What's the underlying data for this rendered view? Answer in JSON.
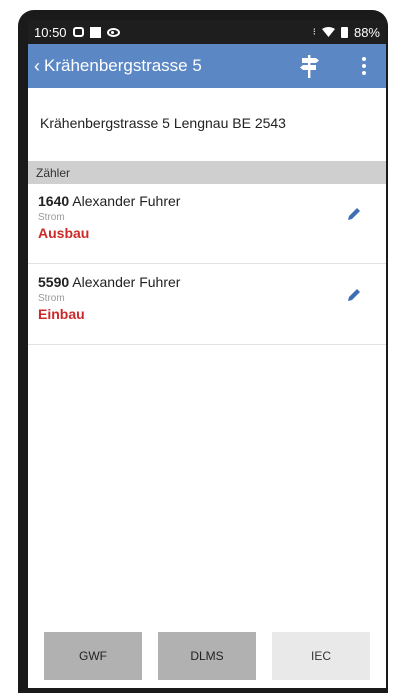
{
  "status_bar": {
    "time": "10:50",
    "signal": "⁝",
    "battery": "88%"
  },
  "app_bar": {
    "back_icon": "‹",
    "title": "Krähenbergstrasse 5",
    "signpost_icon": "signpost-icon",
    "more_icon": "more-vert-icon"
  },
  "address": "Krähenbergstrasse 5 Lengnau BE 2543",
  "section": {
    "title": "Zähler"
  },
  "items": [
    {
      "number": "1640",
      "name": " Alexander Fuhrer",
      "type": "Strom",
      "status": "Ausbau"
    },
    {
      "number": "5590",
      "name": " Alexander Fuhrer",
      "type": "Strom",
      "status": "Einbau"
    }
  ],
  "buttons": {
    "gwf": "GWF",
    "dlms": "DLMS",
    "iec": "IEC"
  },
  "colors": {
    "appbar": "#5b87c5",
    "status_text": "#cc2a2a",
    "edit_icon": "#3f6db3"
  }
}
